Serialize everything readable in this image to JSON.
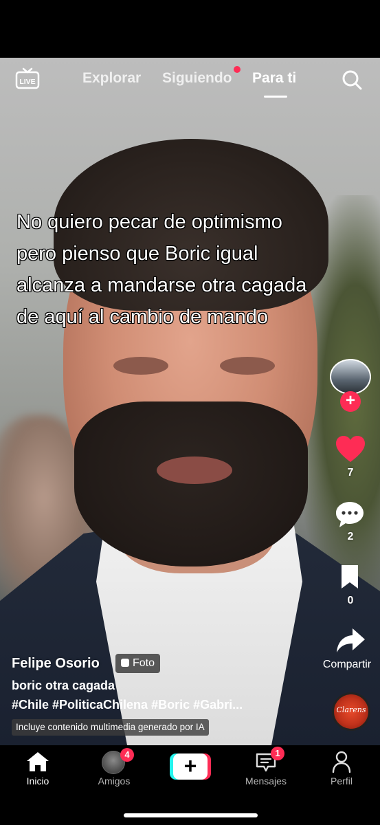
{
  "top_nav": {
    "live_label": "LIVE",
    "tabs": [
      {
        "label": "Explorar",
        "active": false
      },
      {
        "label": "Siguiendo",
        "active": false,
        "has_dot": true
      },
      {
        "label": "Para ti",
        "active": true
      }
    ]
  },
  "post": {
    "overlay_lines": [
      "No quiero pecar de optimismo",
      "pero pienso que Boric igual",
      "alcanza a mandarse otra cagada",
      "de aquí al cambio de mando"
    ],
    "author": "Felipe Osorio",
    "type_badge": "Foto",
    "caption": "boric otra cagada",
    "hashtags": "#Chile #PoliticaChilena #Boric #Gabri...",
    "ai_label": "Incluye contenido multimedia generado por IA"
  },
  "actions": {
    "likes": "7",
    "comments": "2",
    "saves": "0",
    "share_label": "Compartir",
    "music_disc_text": "Clarens"
  },
  "bottom_nav": {
    "items": [
      {
        "label": "Inicio",
        "active": true
      },
      {
        "label": "Amigos",
        "badge": "4"
      },
      {
        "label": "Mensajes",
        "badge": "1"
      },
      {
        "label": "Perfil"
      }
    ],
    "create_symbol": "+"
  },
  "colors": {
    "accent": "#fe2c55",
    "cyan": "#25f4ee"
  }
}
